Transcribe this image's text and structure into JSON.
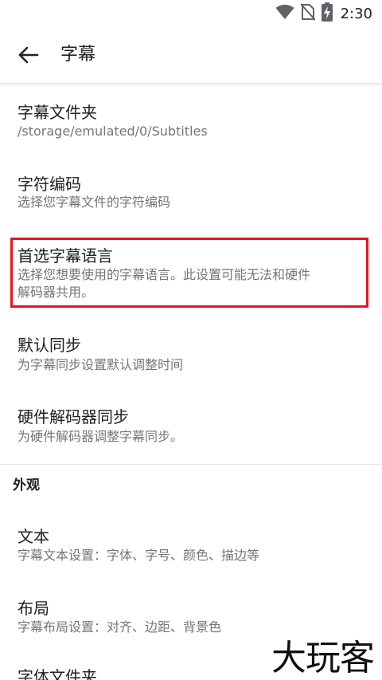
{
  "status_bar": {
    "time": "2:30",
    "icons": [
      "wifi-icon",
      "no-sim-icon",
      "battery-charging-icon"
    ]
  },
  "toolbar": {
    "back_icon": "arrow-left-icon",
    "title": "字幕"
  },
  "items": [
    {
      "title": "字幕文件夹",
      "summary": "/storage/emulated/0/Subtitles"
    },
    {
      "title": "字符编码",
      "summary": "选择您字幕文件的字符编码"
    },
    {
      "title": "首选字幕语言",
      "summary_line1": "选择您想要使用的字幕语言。此设置可能无法和硬件",
      "summary_line2": "解码器共用。"
    },
    {
      "title": "默认同步",
      "summary": "为字幕同步设置默认调整时间"
    },
    {
      "title": "硬件解码器同步",
      "summary": "为硬件解码器调整字幕同步。"
    }
  ],
  "section": {
    "header": "外观",
    "items": [
      {
        "title": "文本",
        "summary": "字幕文本设置：字体、字号、颜色、描边等"
      },
      {
        "title": "布局",
        "summary": "字幕布局设置：对齐、边距、背景色"
      },
      {
        "title": "字体文件夹"
      }
    ]
  },
  "watermark": "大玩客",
  "colors": {
    "highlight": "#e8141b",
    "title_text": "#212121",
    "summary_text": "#757575"
  }
}
